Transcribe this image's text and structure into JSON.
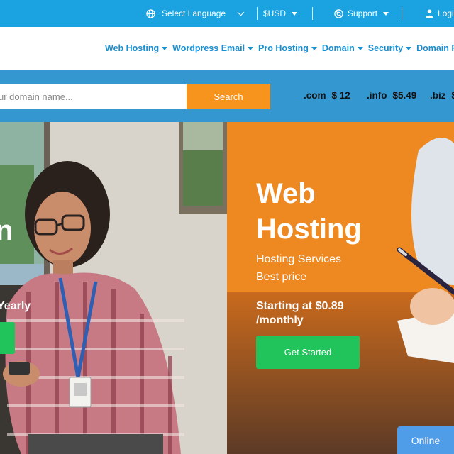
{
  "topbar": {
    "language_label": "Select Language",
    "currency_label": "$USD",
    "support_label": "Support",
    "login_label": "Logi"
  },
  "nav": {
    "items": [
      {
        "label": "Web Hosting"
      },
      {
        "label": "Wordpress Email"
      },
      {
        "label": "Pro Hosting"
      },
      {
        "label": "Domain"
      },
      {
        "label": "Security"
      },
      {
        "label": "Domain R"
      }
    ]
  },
  "search": {
    "placeholder": "ur domain name...",
    "button_label": "Search",
    "tlds": [
      {
        "ext": ".com",
        "price": "$ 12"
      },
      {
        "ext": ".info",
        "price": "$5.49"
      },
      {
        "ext": ".biz",
        "price": "$"
      }
    ]
  },
  "hero": {
    "left": {
      "headline_fragment": "n",
      "pricing_fragment": "Yearly"
    },
    "right": {
      "title_line1": "Web",
      "title_line2": "Hosting",
      "subtitle_line1": "Hosting Services",
      "subtitle_line2": "Best price",
      "price_text": "Starting at $0.89 /monthly",
      "cta_label": "Get Started"
    }
  },
  "chat": {
    "status_label": "Online"
  },
  "colors": {
    "topbar": "#1aa3e0",
    "nav_text": "#1a8fd0",
    "search_band": "#3597cf",
    "search_button": "#f7941d",
    "cta": "#21c45a",
    "online_badge": "#4f9de8"
  }
}
